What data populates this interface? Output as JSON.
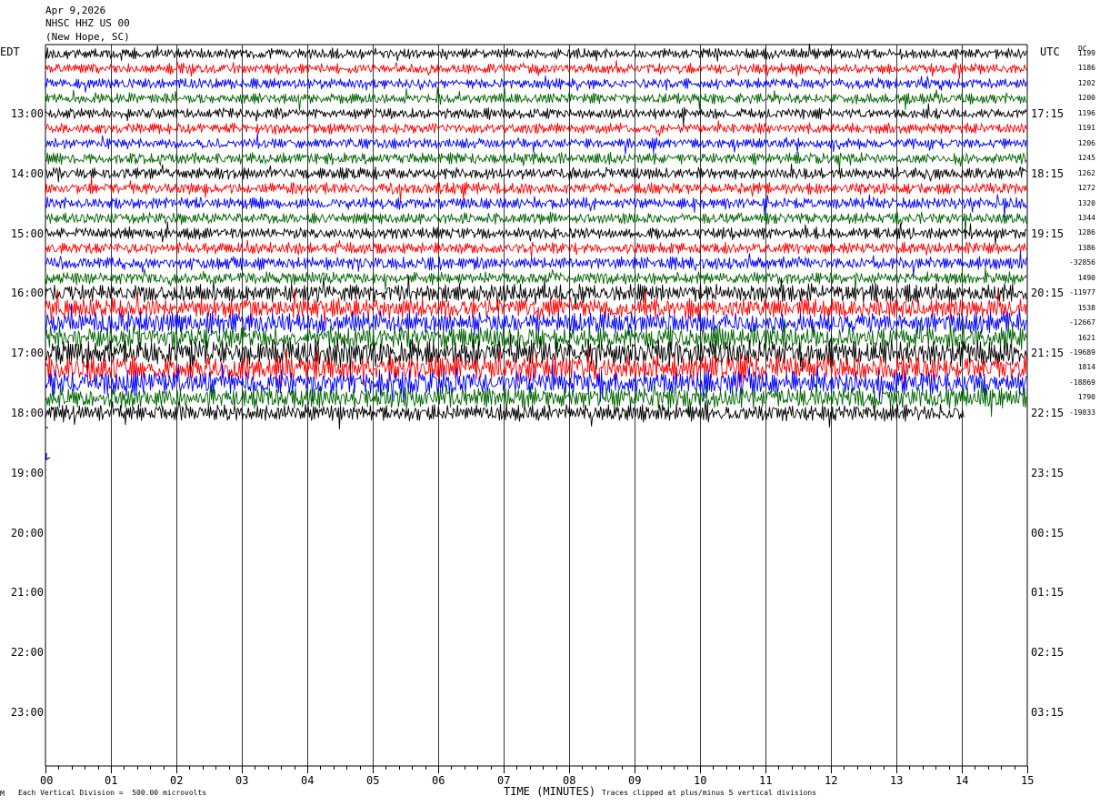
{
  "header": {
    "date": "Apr 9,2026",
    "station": "NHSC HHZ US 00",
    "location": "(New Hope, SC)"
  },
  "left_tz": "EDT",
  "right_tz": "UTC",
  "dc_header": "DC",
  "footer": {
    "scale_note": "Each Vertical Division =  500.00 microvolts",
    "clip_note": "Traces clipped at plus/minus 5 vertical divisions",
    "corner_mark": "M"
  },
  "colors": {
    "trace_cycle": [
      "#000000",
      "#ff0000",
      "#0000ff",
      "#006400"
    ],
    "grid": "#000000"
  },
  "chart_data": {
    "type": "line",
    "title": "",
    "xlabel": "TIME (MINUTES)",
    "x_ticks": [
      "00",
      "01",
      "02",
      "03",
      "04",
      "05",
      "06",
      "07",
      "08",
      "09",
      "10",
      "11",
      "12",
      "13",
      "14",
      "15"
    ],
    "xlim": [
      0,
      15
    ],
    "minutes_per_line": 15,
    "left_hour_labels": [
      "13:00",
      "14:00",
      "15:00",
      "16:00",
      "17:00",
      "18:00",
      "19:00",
      "20:00",
      "21:00",
      "22:00",
      "23:00"
    ],
    "right_hour_labels": [
      "17:15",
      "18:15",
      "19:15",
      "20:15",
      "21:15",
      "22:15",
      "23:15",
      "00:15",
      "01:15",
      "02:15",
      "03:15"
    ],
    "first_line_hour_index": -1,
    "trace_lines": 25,
    "last_line_end_minute": 14.05,
    "dc_offsets": [
      "1199",
      "1186",
      "1202",
      "1200",
      "1196",
      "1191",
      "1206",
      "1245",
      "1262",
      "1272",
      "1320",
      "1344",
      "1286",
      "1386",
      "-32856",
      "1490",
      "-11977",
      "1538",
      "-12667",
      "1621",
      "-19689",
      "1814",
      "-18869",
      "1790",
      "-19833"
    ],
    "amplitude_profile": [
      1,
      1,
      1,
      1,
      1,
      1,
      1,
      1.1,
      1.1,
      1.1,
      1.1,
      1.1,
      1.1,
      1.1,
      1.2,
      1.2,
      1.7,
      1.9,
      2.0,
      2.1,
      2.4,
      2.4,
      2.3,
      2.0,
      1.6
    ]
  }
}
